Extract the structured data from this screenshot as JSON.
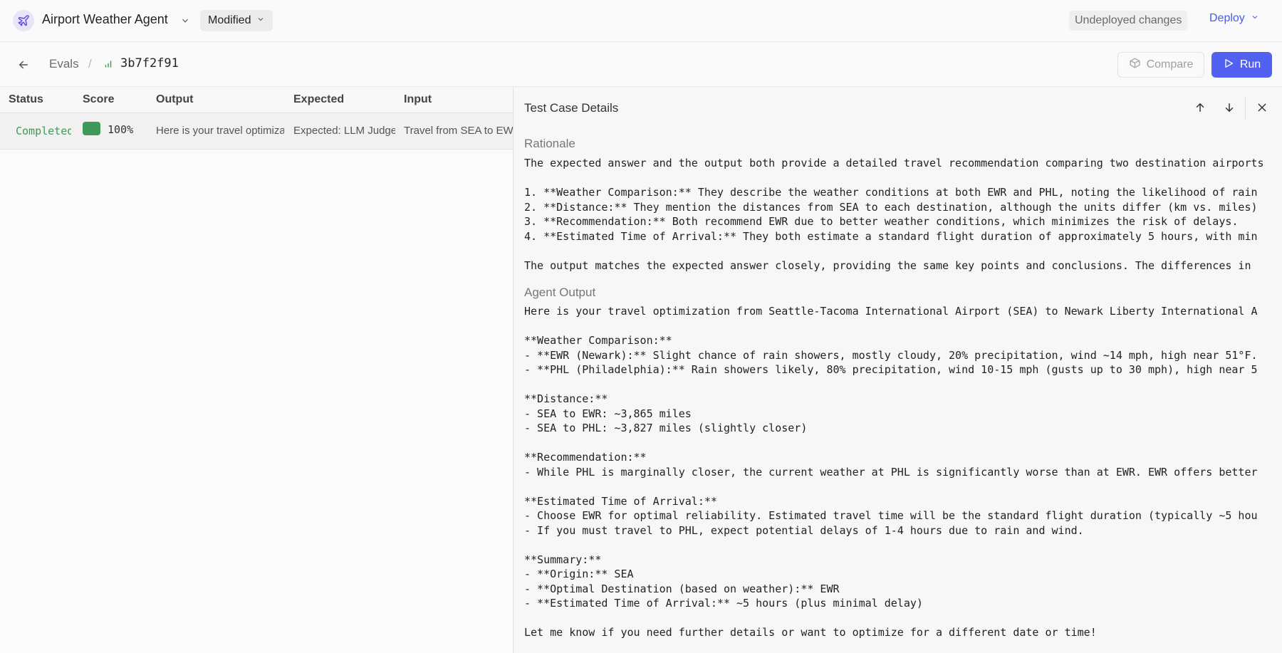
{
  "app": {
    "title": "Airport Weather Agent",
    "modified_label": "Modified",
    "undeployed_label": "Undeployed changes",
    "deploy_label": "Deploy"
  },
  "breadcrumb": {
    "evals": "Evals",
    "separator": "/",
    "id": "3b7f2f91"
  },
  "actions": {
    "compare_label": "Compare",
    "run_label": "Run"
  },
  "table": {
    "headers": [
      "Status",
      "Score",
      "Output",
      "Expected",
      "Input"
    ],
    "rows": [
      {
        "status": "Completed",
        "score": "100%",
        "output": "Here is your travel optimization",
        "expected": "Expected: LLM Judge",
        "input": "Travel from SEA to EWR"
      }
    ]
  },
  "panel": {
    "title": "Test Case Details",
    "rationale_label": "Rationale",
    "rationale_text": "The expected answer and the output both provide a detailed travel recommendation comparing two destination airports\n\n1. **Weather Comparison:** They describe the weather conditions at both EWR and PHL, noting the likelihood of rain\n2. **Distance:** They mention the distances from SEA to each destination, although the units differ (km vs. miles)\n3. **Recommendation:** Both recommend EWR due to better weather conditions, which minimizes the risk of delays.\n4. **Estimated Time of Arrival:** They both estimate a standard flight duration of approximately 5 hours, with min\n\nThe output matches the expected answer closely, providing the same key points and conclusions. The differences in",
    "agent_output_label": "Agent Output",
    "agent_output_text": "Here is your travel optimization from Seattle-Tacoma International Airport (SEA) to Newark Liberty International A\n\n**Weather Comparison:**\n- **EWR (Newark):** Slight chance of rain showers, mostly cloudy, 20% precipitation, wind ~14 mph, high near 51°F.\n- **PHL (Philadelphia):** Rain showers likely, 80% precipitation, wind 10-15 mph (gusts up to 30 mph), high near 5\n\n**Distance:**\n- SEA to EWR: ~3,865 miles\n- SEA to PHL: ~3,827 miles (slightly closer)\n\n**Recommendation:**\n- While PHL is marginally closer, the current weather at PHL is significantly worse than at EWR. EWR offers better\n\n**Estimated Time of Arrival:**\n- Choose EWR for optimal reliability. Estimated travel time will be the standard flight duration (typically ~5 hou\n- If you must travel to PHL, expect potential delays of 1-4 hours due to rain and wind.\n\n**Summary:**\n- **Origin:** SEA\n- **Optimal Destination (based on weather):** EWR\n- **Estimated Time of Arrival:** ~5 hours (plus minimal delay)\n\nLet me know if you need further details or want to optimize for a different date or time!"
  },
  "colors": {
    "accent": "#5361f3",
    "success": "#3e9a5a",
    "link": "#4a5ae8"
  }
}
